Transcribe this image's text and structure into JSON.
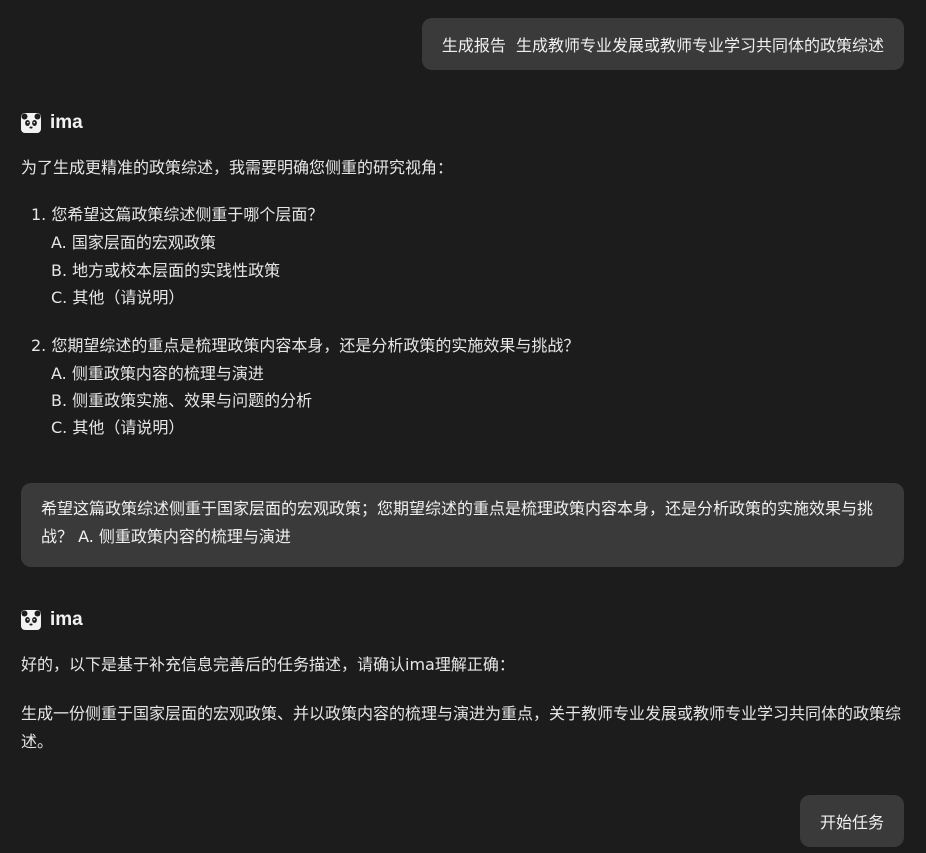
{
  "messages": {
    "user_request": "生成报告  生成教师专业发展或教师专业学习共同体的政策综述",
    "assistant_name": "ima",
    "assistant_intro": "为了生成更精准的政策综述，我需要明确您侧重的研究视角：",
    "questions": [
      {
        "text": "1. 您希望这篇政策综述侧重于哪个层面？",
        "options": [
          "A. 国家层面的宏观政策",
          "B. 地方或校本层面的实践性政策",
          "C. 其他（请说明）"
        ]
      },
      {
        "text": "2. 您期望综述的重点是梳理政策内容本身，还是分析政策的实施效果与挑战？",
        "options": [
          "A. 侧重政策内容的梳理与演进",
          "B. 侧重政策实施、效果与问题的分析",
          "C. 其他（请说明）"
        ]
      }
    ],
    "user_answer": "希望这篇政策综述侧重于国家层面的宏观政策；您期望综述的重点是梳理政策内容本身，还是分析政策的实施效果与挑战？ A. 侧重政策内容的梳理与演进",
    "assistant_confirm": "好的，以下是基于补充信息完善后的任务描述，请确认ima理解正确：",
    "task_description": "生成一份侧重于国家层面的宏观政策、并以政策内容的梳理与演进为重点，关于教师专业发展或教师专业学习共同体的政策综述。",
    "start_button": "开始任务"
  },
  "icons": {
    "assistant_avatar": "panda-icon"
  },
  "colors": {
    "background": "#1c1c1c",
    "bubble": "#3a3a3a",
    "text": "#e6e6e6"
  }
}
